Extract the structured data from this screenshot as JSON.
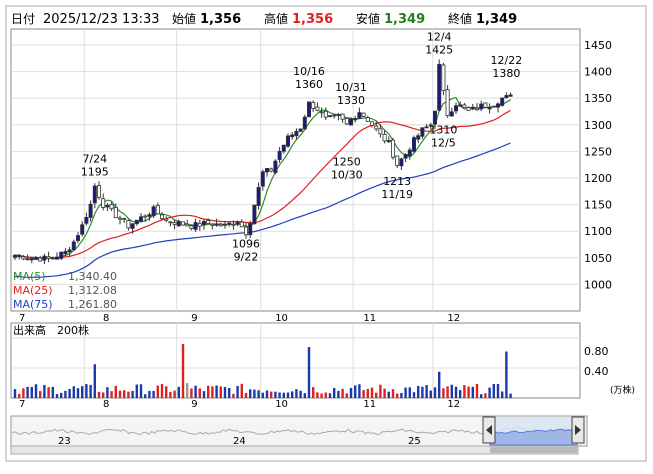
{
  "header": {
    "date_label": "日付",
    "datetime": "2025/12/23 13:33",
    "open_label": "始値",
    "open_value": "1,356",
    "high_label": "高値",
    "high_value": "1,356",
    "low_label": "安値",
    "low_value": "1,349",
    "close_label": "終値",
    "close_value": "1,349"
  },
  "colors": {
    "up": "#1a1a80",
    "down": "#ffffff",
    "ma5": "#2e8b2e",
    "ma25": "#e02020",
    "ma75": "#2040c0",
    "high": "#e02020",
    "low": "#208020",
    "vol_up": "#1a3aa8",
    "vol_down": "#e02020",
    "vol_flat": "#999999"
  },
  "legend": {
    "ma5_label": "MA(5)",
    "ma5_value": "1,340.40",
    "ma25_label": "MA(25)",
    "ma25_value": "1,312.08",
    "ma75_label": "MA(75)",
    "ma75_value": "1,261.80"
  },
  "volume_panel": {
    "title": "出来高",
    "unit": "200株",
    "ticks": [
      "0.80",
      "0.40"
    ],
    "unit_suffix": "(万株)"
  },
  "navigator": {
    "labels": [
      "23",
      "24",
      "25"
    ]
  },
  "chart_data": {
    "type": "candlestick",
    "x_month_labels": [
      "7",
      "8",
      "9",
      "10",
      "11",
      "12"
    ],
    "ylim": [
      950,
      1480
    ],
    "y_ticks": [
      1000,
      1050,
      1100,
      1150,
      1200,
      1250,
      1300,
      1350,
      1400,
      1450
    ],
    "annotations": [
      {
        "date": "7/24",
        "value": 1195,
        "text": "7/24",
        "text2": "1195",
        "pos": "above"
      },
      {
        "date": "9/22",
        "value": 1096,
        "text": "1096",
        "text2": "9/22",
        "pos": "below"
      },
      {
        "date": "10/16",
        "value": 1360,
        "text": "10/16",
        "text2": "1360",
        "pos": "above"
      },
      {
        "date": "10/31",
        "value": 1330,
        "text": "10/31",
        "text2": "1330",
        "pos": "above"
      },
      {
        "date": "10/30",
        "value": 1250,
        "text": "1250",
        "text2": "10/30",
        "pos": "below"
      },
      {
        "date": "11/19",
        "value": 1213,
        "text": "1213",
        "text2": "11/19",
        "pos": "below"
      },
      {
        "date": "12/4",
        "value": 1425,
        "text": "12/4",
        "text2": "1425",
        "pos": "above"
      },
      {
        "date": "12/5",
        "value": 1310,
        "text": "1310",
        "text2": "12/5",
        "pos": "below"
      },
      {
        "date": "12/22",
        "value": 1380,
        "text": "12/22",
        "text2": "1380",
        "pos": "above"
      }
    ]
  }
}
